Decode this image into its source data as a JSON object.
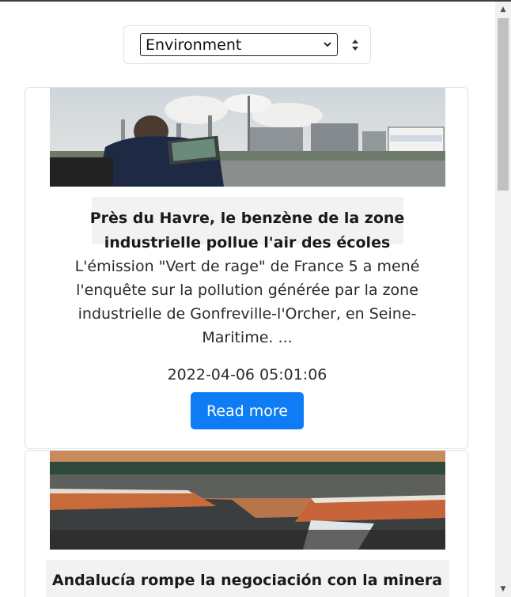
{
  "filter": {
    "selected": "Environment"
  },
  "articles": [
    {
      "title": "Près du Havre, le benzène de la zone industrielle pollue l'air des écoles",
      "excerpt": "L'émission \"Vert de rage\" de France 5 a mené l'enquête sur la pollution générée par la zone industrielle de Gonfreville-l'Orcher, en Seine-Maritime. ...",
      "date": "2022-04-06 05:01:06",
      "button_label": "Read more",
      "image": "industrial-zone-photo"
    },
    {
      "title": "Andalucía rompe la negociación con la minera",
      "image": "mining-dam-photo"
    }
  ],
  "colors": {
    "button": "#0d7cf5",
    "card_border": "#dee2e6"
  }
}
